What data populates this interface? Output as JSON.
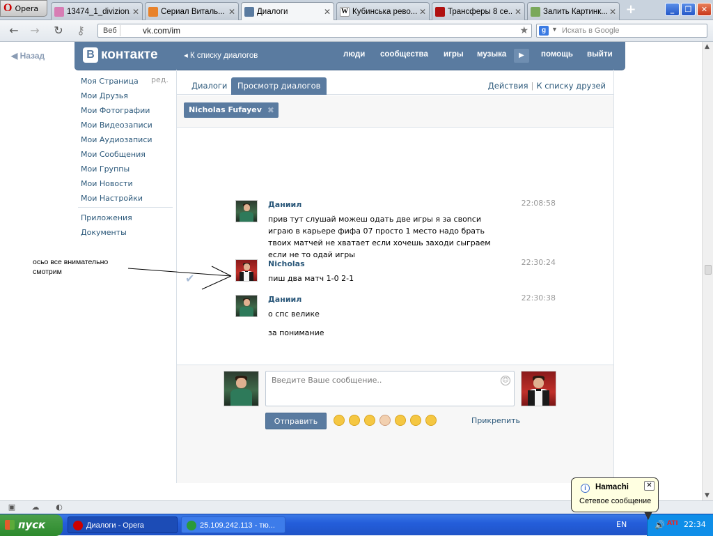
{
  "browser": {
    "opera_label": "Opera",
    "tabs": [
      {
        "title": "13474_1_divizion...",
        "active": false
      },
      {
        "title": "Сериал Виталь...",
        "active": false
      },
      {
        "title": "Диалоги",
        "active": true
      },
      {
        "title": "Кубинська рево...",
        "active": false
      },
      {
        "title": "Трансферы 8 се...",
        "active": false
      },
      {
        "title": "Залить Картинк...",
        "active": false
      }
    ],
    "web_badge": "Веб",
    "url": "vk.com/im",
    "search_placeholder": "Искать в Google"
  },
  "vk": {
    "back": "Назад",
    "logo": "контакте",
    "logo_b": "В",
    "to_dialogs": "К списку диалогов",
    "nav": [
      "люди",
      "сообщества",
      "игры",
      "музыка",
      "помощь",
      "выйти"
    ],
    "menu": [
      "Моя Страница",
      "Мои Друзья",
      "Мои Фотографии",
      "Мои Видеозаписи",
      "Мои Аудиозаписи",
      "Мои Сообщения",
      "Мои Группы",
      "Мои Новости",
      "Мои Настройки"
    ],
    "menu_edit": "ред.",
    "menu2": [
      "Приложения",
      "Документы"
    ],
    "tabs": [
      "Диалоги",
      "Просмотр диалогов"
    ],
    "actions": "Действия",
    "to_friends": "К списку друзей",
    "peer": "Nicholas Fufayev",
    "messages": [
      {
        "name": "Даниил",
        "time": "22:08:58",
        "text": "прив тут слушай можеш одать две игры я за своnси играю в карьере фифа 07 просто 1 место надо брать твоих матчей не хватает если хочешь заходи сыграем если не то одай игры"
      },
      {
        "name": "Nicholas",
        "time": "22:30:24",
        "text": "пиш два матч 1-0 2-1"
      },
      {
        "name": "Даниил",
        "time": "22:30:38",
        "text": "о спс велике"
      },
      {
        "name": "",
        "time": "",
        "text": "за понимание"
      }
    ],
    "input_placeholder": "Введите Ваше сообщение..",
    "send": "Отправить",
    "attach": "Прикрепить"
  },
  "annotation": "осьо все внимательно смотрим",
  "taskbar": {
    "start": "пуск",
    "tasks": [
      "Диалоги - Opera",
      "25.109.242.113 - тю..."
    ],
    "lang": "EN",
    "clock": "22:34"
  },
  "balloon": {
    "title": "Hamachi",
    "message": "Сетевое сообщение"
  }
}
